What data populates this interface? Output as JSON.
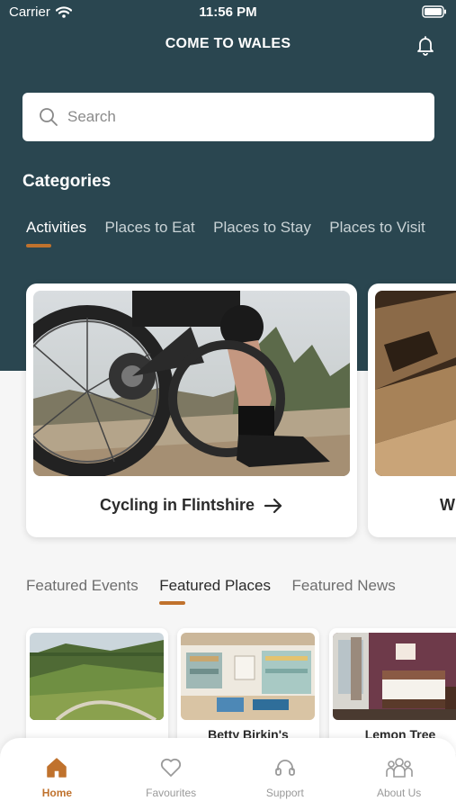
{
  "status": {
    "carrier": "Carrier",
    "time": "11:56 PM"
  },
  "header": {
    "title": "COME TO WALES",
    "bell_icon": "bell-icon"
  },
  "search": {
    "placeholder": "Search",
    "value": ""
  },
  "categories": {
    "heading": "Categories",
    "tabs": [
      "Activities",
      "Places to Eat",
      "Places to Stay",
      "Places to Visit"
    ],
    "active": "Activities"
  },
  "activities": [
    {
      "title": "Cycling in Flintshire",
      "arrow_icon": "arrow-right-icon"
    },
    {
      "title": "W"
    }
  ],
  "featured": {
    "tabs": [
      "Featured Events",
      "Featured Places",
      "Featured News"
    ],
    "active": "Featured Places",
    "items": [
      {
        "title": ""
      },
      {
        "title": "Betty Birkin's"
      },
      {
        "title": "Lemon Tree"
      }
    ]
  },
  "nav": [
    {
      "label": "Home",
      "icon": "home-icon",
      "active": true
    },
    {
      "label": "Favourites",
      "icon": "heart-icon",
      "active": false
    },
    {
      "label": "Support",
      "icon": "headset-icon",
      "active": false
    },
    {
      "label": "About Us",
      "icon": "people-icon",
      "active": false
    }
  ],
  "colors": {
    "header_bg": "#2a4650",
    "accent": "#c0722d",
    "background": "#f6f6f6"
  }
}
